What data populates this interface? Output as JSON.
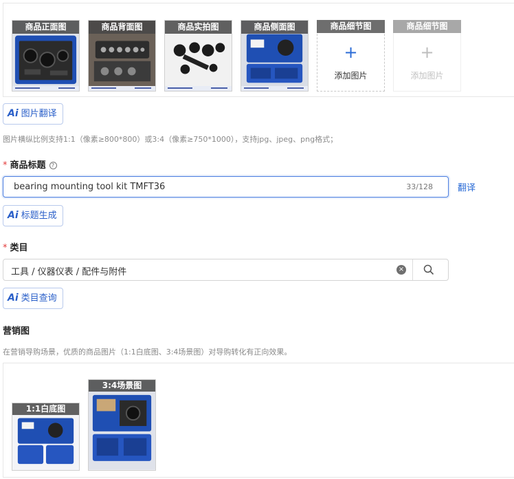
{
  "images": {
    "slots": [
      {
        "caption": "商品正面图"
      },
      {
        "caption": "商品背面图"
      },
      {
        "caption": "商品实拍图"
      },
      {
        "caption": "商品侧面图"
      }
    ],
    "add_slots": [
      {
        "caption": "商品细节图",
        "label": "添加图片",
        "state": "active"
      },
      {
        "caption": "商品细节图",
        "label": "添加图片",
        "state": "disabled"
      }
    ],
    "translate_button": "图片翻译",
    "hint": "图片横纵比例支持1:1（像素≥800*800）或3:4（像素≥750*1000），支持jpg、jpeg、png格式；"
  },
  "title_field": {
    "required_mark": "*",
    "label": "商品标题",
    "help_icon": "?",
    "value": "bearing mounting tool kit TMFT36",
    "counter": "33/128",
    "translate_link": "翻译",
    "generate_button": "标题生成"
  },
  "category_field": {
    "required_mark": "*",
    "label": "类目",
    "value": "工具 / 仪器仪表 / 配件与附件",
    "clear_icon": "×",
    "query_button": "类目查询"
  },
  "marketing": {
    "label": "营销图",
    "hint": "在营销导购场景，优质的商品图片（1:1白底图、3:4场景图）对导购转化有正向效果。",
    "images": [
      {
        "caption": "1:1白底图"
      },
      {
        "caption": "3:4场景图"
      }
    ]
  },
  "ai_badge": "Ai",
  "colors": {
    "accent": "#2a6bd6",
    "ai_border": "#b8c9ec",
    "required": "#e23b3b",
    "case_blue": "#1f4fb3"
  }
}
